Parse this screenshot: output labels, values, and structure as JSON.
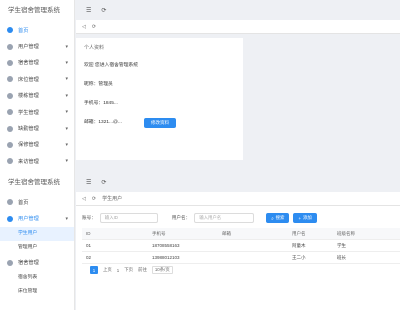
{
  "window1": {
    "brand": "学生宿舍管理系统",
    "nav": [
      {
        "label": "首页",
        "icon": "home-icon",
        "active": true
      },
      {
        "label": "用户管理",
        "icon": "user-icon"
      },
      {
        "label": "宿舍管理",
        "icon": "building-icon"
      },
      {
        "label": "床位管理",
        "icon": "bed-icon"
      },
      {
        "label": "楼栋管理",
        "icon": "tower-icon"
      },
      {
        "label": "学生管理",
        "icon": "student-icon"
      },
      {
        "label": "缺勤管理",
        "icon": "absence-icon"
      },
      {
        "label": "保修管理",
        "icon": "wrench-icon"
      },
      {
        "label": "来访管理",
        "icon": "visitor-icon"
      }
    ],
    "card": {
      "title": "个人资料",
      "rows": [
        "欢迎 您进入宿舍管理系统",
        "昵称：管理员",
        "手机号：1845...",
        "邮箱：1321...@..."
      ],
      "button": "修改资料"
    }
  },
  "window2": {
    "brand": "学生宿舍管理系统",
    "tab": "学生用户",
    "nav": [
      {
        "label": "首页",
        "icon": "home-icon"
      },
      {
        "label": "用户管理",
        "icon": "user-icon",
        "active": true
      }
    ],
    "sub_items": [
      {
        "label": "学生用户",
        "active": true
      },
      {
        "label": "管理用户"
      }
    ],
    "nav_after": [
      {
        "label": "宿舍管理",
        "icon": "building-icon"
      }
    ],
    "sub_items2": [
      {
        "label": "宿舍列表"
      },
      {
        "label": "床位管理"
      }
    ],
    "search": {
      "label1": "账号：",
      "placeholder1": "输入ID",
      "label2": "用户名：",
      "placeholder2": "输入用户名",
      "search_btn": "搜索",
      "add_btn": "添加"
    },
    "table": {
      "headers": [
        "ID",
        "手机号",
        "邮箱",
        "用户名",
        "班级名称"
      ],
      "rows": [
        [
          "01",
          "18708558163",
          "",
          "阿童木",
          "学生"
        ],
        [
          "02",
          "13988012103",
          "",
          "王二小",
          "班长"
        ]
      ]
    },
    "pager": {
      "prev": "上页",
      "page": "1",
      "next": "下页",
      "goto": "前往",
      "size": "10条/页"
    }
  }
}
